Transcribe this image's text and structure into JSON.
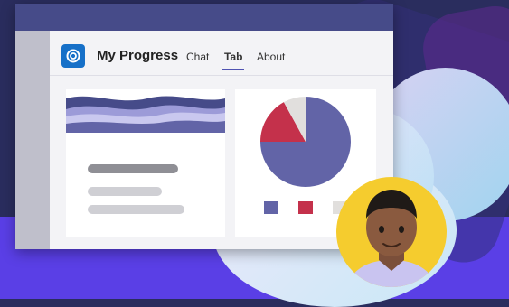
{
  "app": {
    "title": "My Progress",
    "tabs": [
      {
        "label": "Chat"
      },
      {
        "label": "Tab",
        "selected": true
      },
      {
        "label": "About"
      }
    ]
  },
  "colors": {
    "accent": "#4f52b2",
    "titlebar": "#464b89",
    "pie_main": "#6264a7",
    "pie_red": "#c4314b",
    "pie_light": "#e1dfdd"
  },
  "pie": {
    "slices": [
      {
        "share": 0.75,
        "color": "#6264a7"
      },
      {
        "share": 0.17,
        "color": "#c4314b"
      },
      {
        "share": 0.08,
        "color": "#e1dfdd"
      }
    ]
  },
  "legend": {
    "swatches": [
      "#6264a7",
      "#c4314b",
      "#e1dfdd"
    ]
  },
  "icons": {
    "app_icon": "app-logo-icon"
  }
}
